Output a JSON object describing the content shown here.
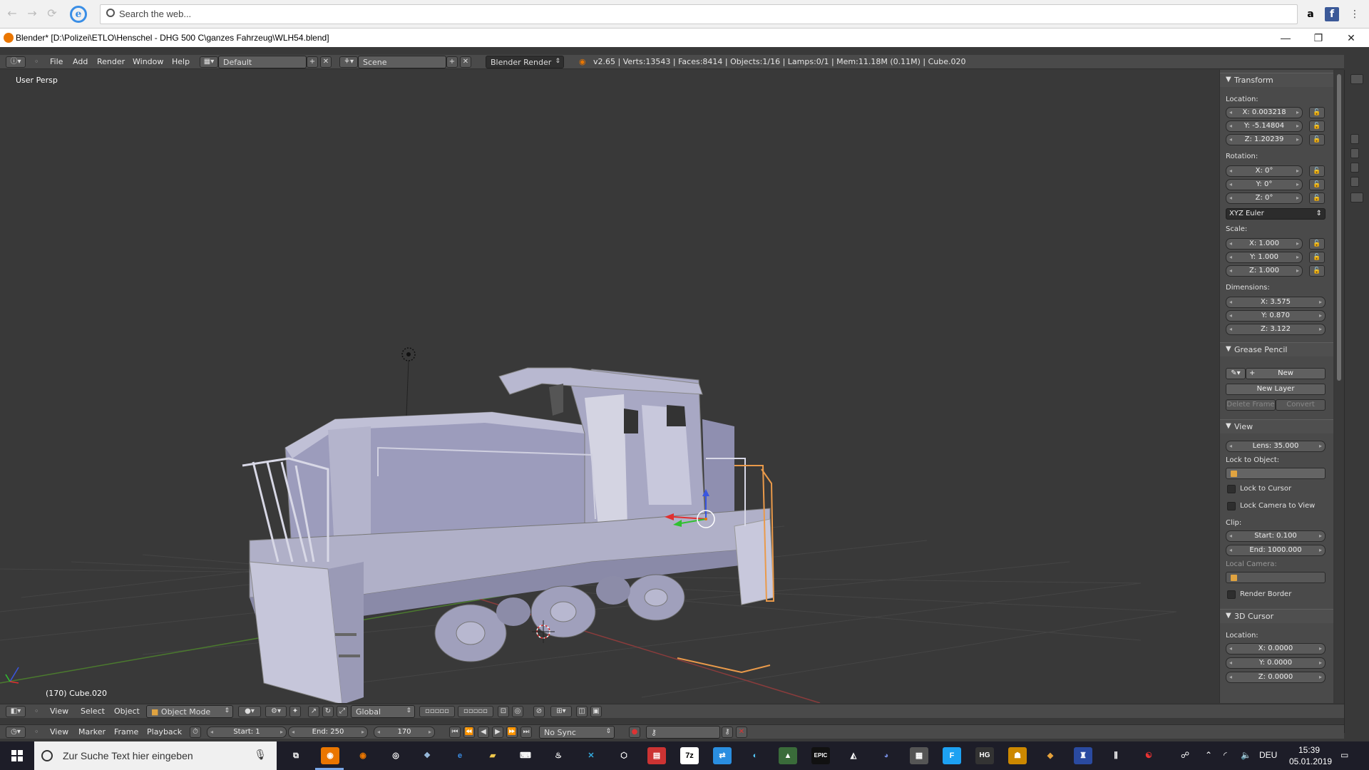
{
  "browser": {
    "search_placeholder": "Search the web..."
  },
  "window": {
    "title": "Blender* [D:\\Polizei\\ETLO\\Henschel - DHG 500 C\\ganzes Fahrzeug\\WLH54.blend]"
  },
  "header": {
    "menus": [
      "File",
      "Add",
      "Render",
      "Window",
      "Help"
    ],
    "screen_layout": "Default",
    "scene": "Scene",
    "engine": "Blender Render",
    "stats": "v2.65 | Verts:13543 | Faces:8414 | Objects:1/16 | Lamps:0/1 | Mem:11.18M (0.11M) | Cube.020"
  },
  "viewport": {
    "persp_label": "User Persp",
    "object_label": "(170) Cube.020"
  },
  "panel": {
    "transform": {
      "title": "Transform",
      "location_label": "Location:",
      "location": [
        "X: 0.003218",
        "Y: -5.14804",
        "Z: 1.20239"
      ],
      "rotation_label": "Rotation:",
      "rotation": [
        "X: 0°",
        "Y: 0°",
        "Z: 0°"
      ],
      "rotation_mode": "XYZ Euler",
      "scale_label": "Scale:",
      "scale": [
        "X: 1.000",
        "Y: 1.000",
        "Z: 1.000"
      ],
      "dimensions_label": "Dimensions:",
      "dimensions": [
        "X: 3.575",
        "Y: 0.870",
        "Z: 3.122"
      ]
    },
    "grease_pencil": {
      "title": "Grease Pencil",
      "new": "New",
      "new_layer": "New Layer",
      "delete_frame": "Delete Frame",
      "convert": "Convert"
    },
    "view": {
      "title": "View",
      "lens": "Lens: 35.000",
      "lock_to_object": "Lock to Object:",
      "lock_to_cursor": "Lock to Cursor",
      "lock_camera_to_view": "Lock Camera to View",
      "clip_label": "Clip:",
      "clip_start": "Start: 0.100",
      "clip_end": "End: 1000.000",
      "local_camera": "Local Camera:",
      "render_border": "Render Border"
    },
    "cursor": {
      "title": "3D Cursor",
      "location_label": "Location:",
      "location": [
        "X: 0.0000",
        "Y: 0.0000",
        "Z: 0.0000"
      ]
    }
  },
  "view_header": {
    "menus": [
      "View",
      "Select",
      "Object"
    ],
    "mode": "Object Mode",
    "orientation": "Global"
  },
  "timeline": {
    "menus": [
      "View",
      "Marker",
      "Frame",
      "Playback"
    ],
    "start": "Start: 1",
    "end": "End: 250",
    "current": "170",
    "sync": "No Sync"
  },
  "taskbar": {
    "search_placeholder": "Zur Suche Text hier eingeben",
    "language": "DEU",
    "time": "15:39",
    "date": "05.01.2019"
  },
  "colors": {
    "accent": "#ea7600",
    "mesh": "#a9a9c4",
    "viewport_bg": "#393939"
  }
}
